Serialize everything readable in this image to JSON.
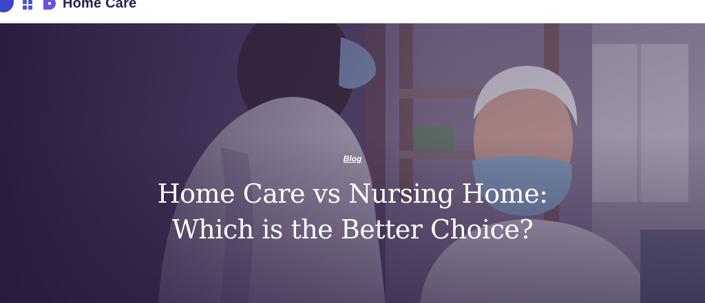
{
  "header": {
    "brand": "Home Care",
    "colors": {
      "primary": "#3d45c9",
      "accent": "#6b4fe0",
      "text": "#22224d"
    },
    "icons": [
      "logo-mark-icon",
      "grid-menu-icon",
      "brand-logo-icon"
    ]
  },
  "hero": {
    "category": "Blog",
    "title_line1": "Home Care vs Nursing Home:",
    "title_line2": "Which is the Better Choice?",
    "background": "photo-nurse-and-elderly-man-wearing-masks"
  }
}
